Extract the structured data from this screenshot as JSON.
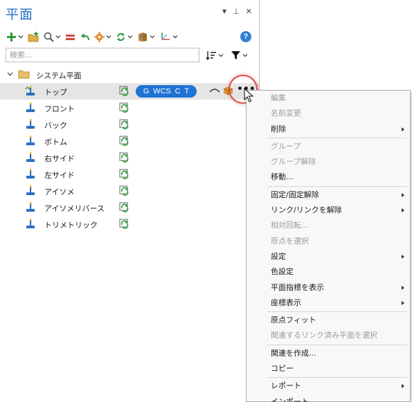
{
  "panel": {
    "title": "平面",
    "controls": {
      "dropdown": "▼",
      "pin": "⊥",
      "close": "✕"
    }
  },
  "toolbar": {
    "items": [
      "add-icon",
      "new-folder-icon",
      "search-zoom-icon",
      "equal-icon",
      "undo-icon",
      "gear-icon",
      "refresh-icon",
      "book-icon",
      "axis-icon"
    ],
    "help": "?"
  },
  "search": {
    "placeholder": "検索...",
    "value": ""
  },
  "tree": {
    "root": {
      "label": "システム平面"
    },
    "items": [
      {
        "label": "トップ",
        "selected": true
      },
      {
        "label": "フロント"
      },
      {
        "label": "バック"
      },
      {
        "label": "ボトム"
      },
      {
        "label": "右サイド"
      },
      {
        "label": "左サイド"
      },
      {
        "label": "アイソメ"
      },
      {
        "label": "アイソメリバース"
      },
      {
        "label": "トリメトリック"
      }
    ],
    "badge": [
      "G",
      "WCS",
      "C",
      "T"
    ],
    "more": "•••"
  },
  "menu": {
    "items": [
      {
        "label": "編集",
        "disabled": true
      },
      {
        "label": "名前変更",
        "disabled": true
      },
      {
        "label": "削除",
        "submenu": true
      },
      {
        "sep": true
      },
      {
        "label": "グループ",
        "disabled": true
      },
      {
        "label": "グループ解除",
        "disabled": true
      },
      {
        "label": "移動..."
      },
      {
        "sep": true
      },
      {
        "label": "固定/固定解除",
        "submenu": true
      },
      {
        "label": "リンク/リンクを解除",
        "submenu": true
      },
      {
        "label": "相対回転...",
        "disabled": true
      },
      {
        "label": "原点を選択",
        "disabled": true
      },
      {
        "label": "設定",
        "submenu": true
      },
      {
        "label": "色設定"
      },
      {
        "label": "平面指標を表示",
        "submenu": true
      },
      {
        "label": "座標表示",
        "submenu": true
      },
      {
        "sep": true
      },
      {
        "label": "原点フィット"
      },
      {
        "label": "関連するリンク済み平面を選択",
        "disabled": true
      },
      {
        "sep": true
      },
      {
        "label": "関連を作成..."
      },
      {
        "label": "コピー"
      },
      {
        "sep": true
      },
      {
        "label": "レポート",
        "submenu": true
      },
      {
        "label": "インポート..."
      }
    ]
  },
  "colors": {
    "accent": "#1f73d4",
    "title": "#1e6fbf",
    "highlight": "#e04a4a"
  }
}
